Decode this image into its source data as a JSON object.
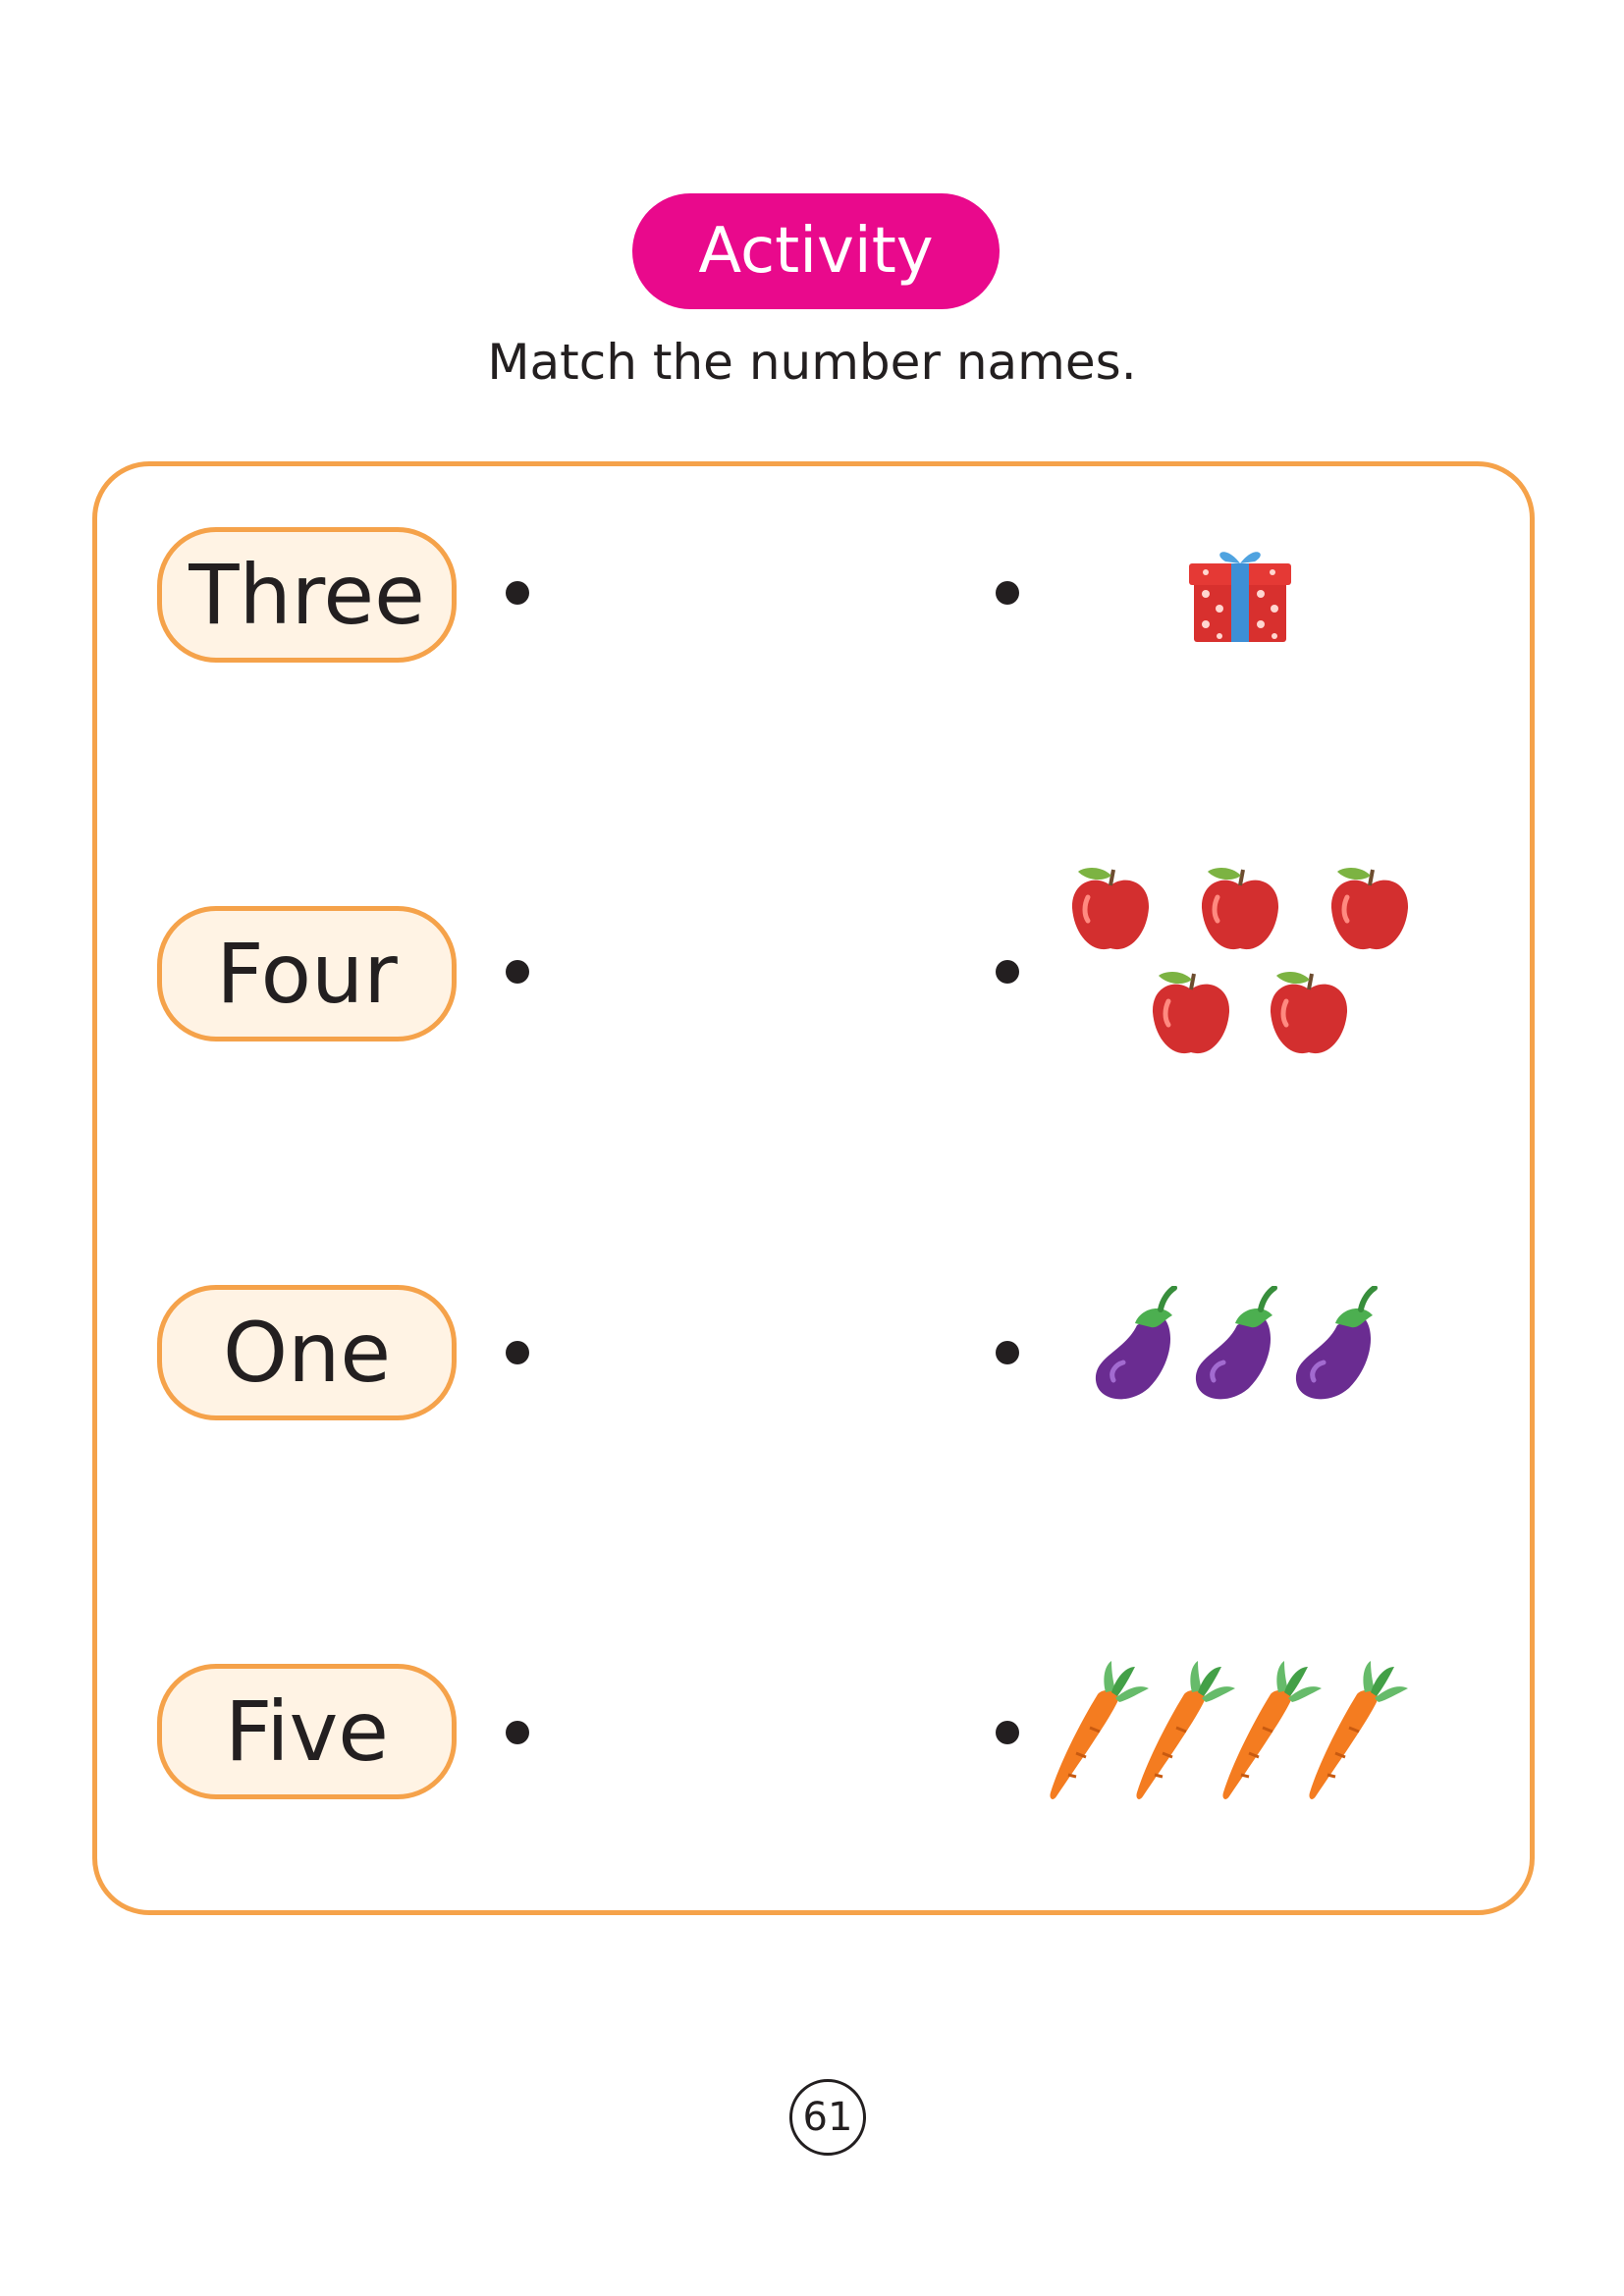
{
  "header": {
    "activity_label": "Activity",
    "instruction": "Match the number names."
  },
  "rows": [
    {
      "word": "Three",
      "picture": "gift-box",
      "picture_count": 1
    },
    {
      "word": "Four",
      "picture": "apple",
      "picture_count": 5
    },
    {
      "word": "One",
      "picture": "eggplant",
      "picture_count": 3
    },
    {
      "word": "Five",
      "picture": "carrot",
      "picture_count": 4
    }
  ],
  "footer": {
    "page_number": "61"
  },
  "colors": {
    "activity_pill": "#e9098c",
    "panel_border": "#f5a24a",
    "word_box_fill": "#fff3e4",
    "text": "#231f20"
  }
}
